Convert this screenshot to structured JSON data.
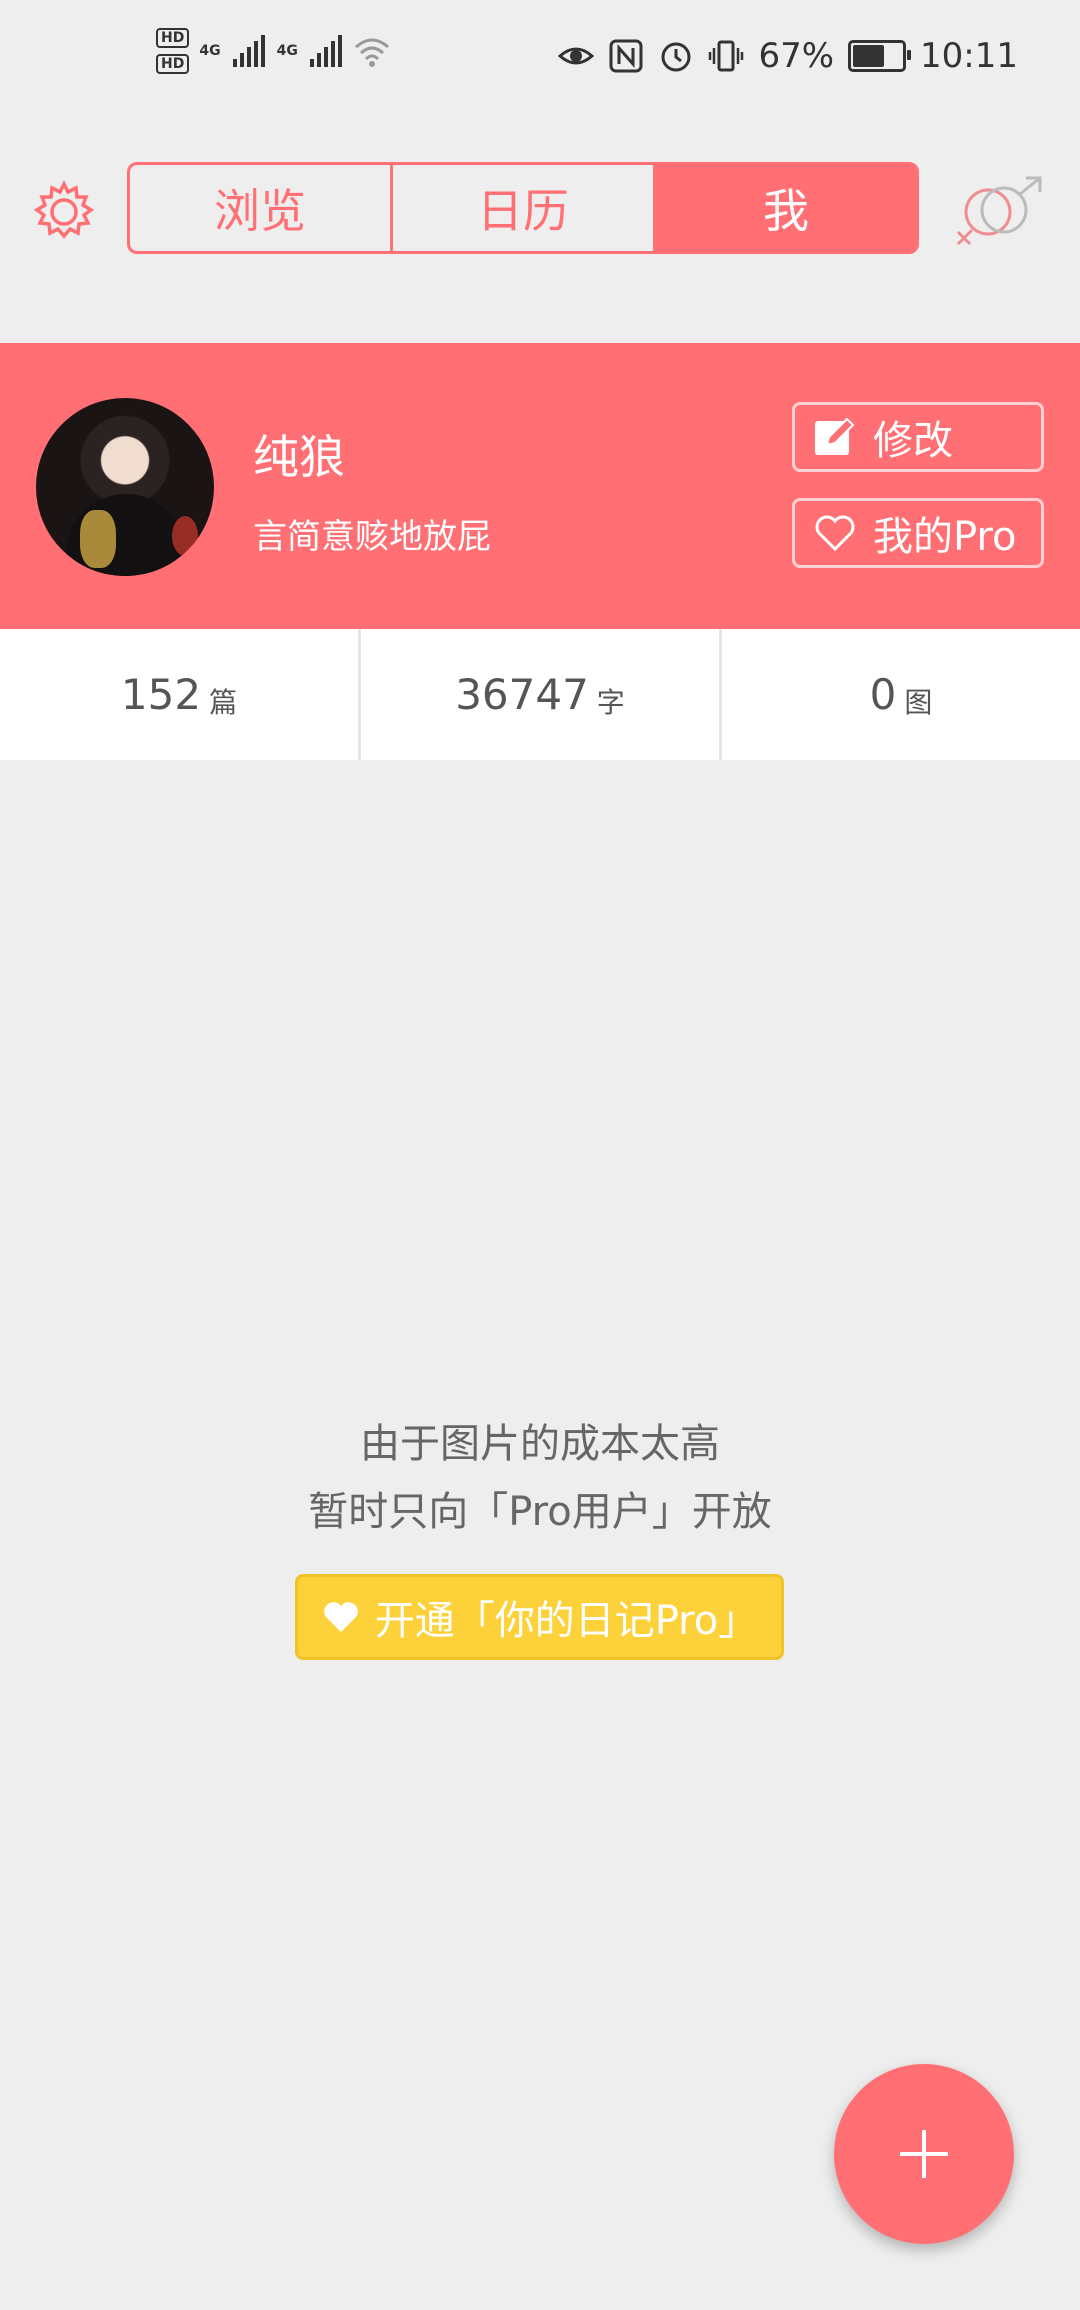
{
  "status_bar": {
    "hd1": "HD",
    "hd2": "HD",
    "sim1_label": "4G",
    "sim2_label": "4G",
    "battery_percent": "67%",
    "time": "10:11",
    "battery_level": 0.67
  },
  "header": {
    "tabs": [
      {
        "label": "浏览",
        "active": false
      },
      {
        "label": "日历",
        "active": false
      },
      {
        "label": "我",
        "active": true
      }
    ]
  },
  "profile": {
    "username": "纯狼",
    "bio": "言简意赅地放屁",
    "edit_label": "修改",
    "pro_label": "我的Pro"
  },
  "stats": [
    {
      "value": "152",
      "unit": "篇"
    },
    {
      "value": "36747",
      "unit": "字"
    },
    {
      "value": "0",
      "unit": "图"
    }
  ],
  "notice": {
    "line1": "由于图片的成本太高",
    "line2": "暂时只向「Pro用户」开放",
    "button_label": "开通「你的日记Pro」"
  },
  "colors": {
    "accent": "#ff6f73",
    "pro_yellow": "#fdd13a",
    "background": "#eeeeee"
  },
  "icons": [
    "gear-icon",
    "gender-icon",
    "edit-icon",
    "heart-icon",
    "plus-icon",
    "eye-icon",
    "nfc-icon",
    "alarm-icon",
    "vibrate-icon",
    "wifi-icon",
    "signal-icon",
    "battery-icon"
  ]
}
